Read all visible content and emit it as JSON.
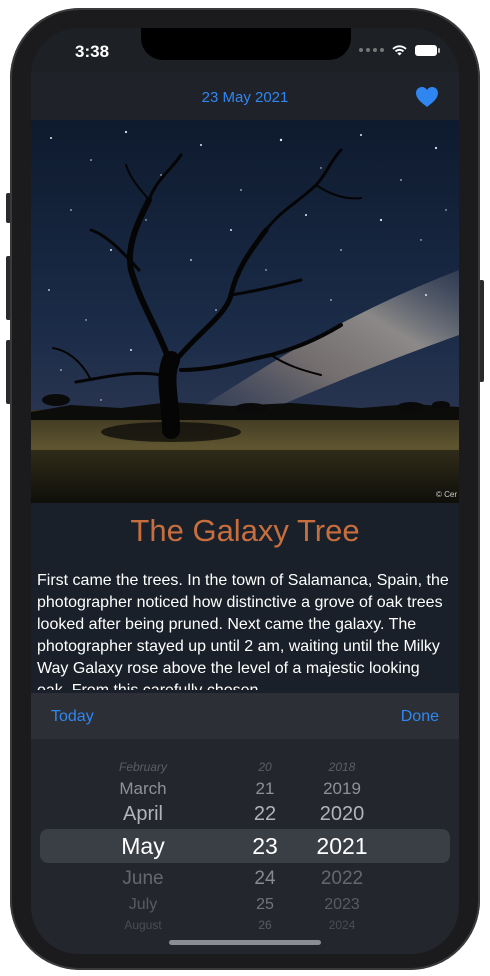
{
  "status": {
    "time": "3:38"
  },
  "nav": {
    "title": "23 May 2021"
  },
  "article": {
    "title": "The Galaxy Tree",
    "body": "First came the trees. In the town of Salamanca, Spain, the photographer noticed how distinctive a grove of oak trees looked after being pruned.  Next came the galaxy. The photographer stayed up until 2 am, waiting until the Milky Way Galaxy rose above the level of a majestic looking oak.  From this carefully chosen",
    "credit": "© Cer"
  },
  "toolbar": {
    "today_label": "Today",
    "done_label": "Done"
  },
  "picker": {
    "months": [
      "February",
      "March",
      "April",
      "May",
      "June",
      "July",
      "August"
    ],
    "days": [
      "20",
      "21",
      "22",
      "23",
      "24",
      "25",
      "26"
    ],
    "years": [
      "2018",
      "2019",
      "2020",
      "2021",
      "2022",
      "2023",
      "2024"
    ],
    "selected": {
      "month": "May",
      "day": "23",
      "year": "2021"
    }
  },
  "colors": {
    "accent": "#2f86f0",
    "title": "#c76e3f",
    "background": "#1d2126"
  },
  "icons": {
    "favorite": "heart-icon",
    "wifi": "wifi-icon",
    "battery": "battery-icon",
    "signal": "signal-icon"
  }
}
